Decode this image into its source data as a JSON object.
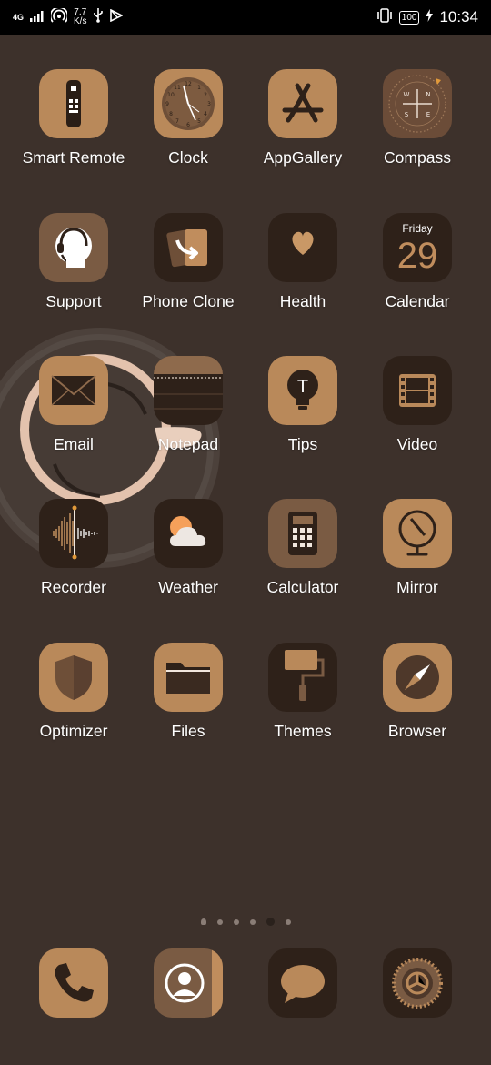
{
  "status_bar": {
    "network": "4G",
    "speed_value": "7.7",
    "speed_unit": "K/s",
    "battery": "100",
    "time": "10:34"
  },
  "apps": [
    {
      "label": "Smart Remote",
      "icon": "remote-icon"
    },
    {
      "label": "Clock",
      "icon": "clock-icon"
    },
    {
      "label": "AppGallery",
      "icon": "appgallery-icon"
    },
    {
      "label": "Compass",
      "icon": "compass-icon"
    },
    {
      "label": "Support",
      "icon": "support-headset-icon"
    },
    {
      "label": "Phone Clone",
      "icon": "phone-clone-icon"
    },
    {
      "label": "Health",
      "icon": "heart-icon"
    },
    {
      "label": "Calendar",
      "icon": "calendar-icon"
    },
    {
      "label": "Email",
      "icon": "envelope-icon"
    },
    {
      "label": "Notepad",
      "icon": "notepad-icon"
    },
    {
      "label": "Tips",
      "icon": "lightbulb-icon"
    },
    {
      "label": "Video",
      "icon": "film-icon"
    },
    {
      "label": "Recorder",
      "icon": "waveform-icon"
    },
    {
      "label": "Weather",
      "icon": "sun-cloud-icon"
    },
    {
      "label": "Calculator",
      "icon": "calculator-icon"
    },
    {
      "label": "Mirror",
      "icon": "mirror-icon"
    },
    {
      "label": "Optimizer",
      "icon": "shield-icon"
    },
    {
      "label": "Files",
      "icon": "folder-icon"
    },
    {
      "label": "Themes",
      "icon": "paint-roller-icon"
    },
    {
      "label": "Browser",
      "icon": "browser-compass-icon"
    }
  ],
  "calendar": {
    "weekday": "Friday",
    "day": "29"
  },
  "compass_letters": {
    "n": "N",
    "s": "S",
    "e": "E",
    "w": "W"
  },
  "tips_letter": "T",
  "page_indicator": {
    "count": 6,
    "active_index": 4
  },
  "dock": [
    {
      "name": "phone",
      "icon": "phone-icon"
    },
    {
      "name": "contacts",
      "icon": "contacts-icon"
    },
    {
      "name": "messages",
      "icon": "message-bubble-icon"
    },
    {
      "name": "settings",
      "icon": "settings-gear-icon"
    }
  ],
  "colors": {
    "background": "#3d312b",
    "icon_light": "#b98a5a",
    "icon_mid": "#7a5b43",
    "icon_dark": "#2e2119",
    "accent_cream": "#f3e6d7"
  }
}
